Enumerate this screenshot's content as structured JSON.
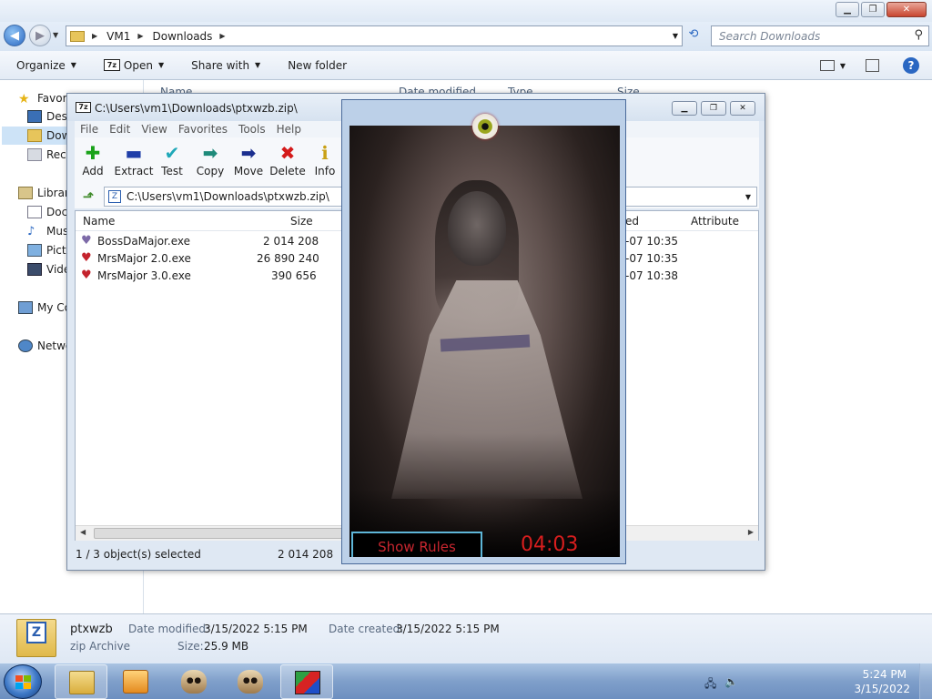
{
  "explorer": {
    "window_controls": {
      "minimize": "▁",
      "maximize": "❐",
      "close": "✕"
    },
    "address": {
      "crumbs": [
        "VM1",
        "Downloads"
      ]
    },
    "search_placeholder": "Search Downloads",
    "commands": {
      "organize": "Organize",
      "open": "Open",
      "share": "Share with",
      "new_folder": "New folder",
      "open_logo": "7z"
    },
    "nav": {
      "favorites": "Favori",
      "desktop": "Desk",
      "downloads": "Dow",
      "recent": "Rece",
      "libraries": "Librari",
      "documents": "Doc",
      "music": "Mus",
      "pictures": "Pictu",
      "videos": "Vide",
      "my_computer": "My Co",
      "network": "Netwo"
    },
    "columns": {
      "name": "Name",
      "date_modified": "Date modified",
      "type": "Type",
      "size": "Size"
    },
    "details": {
      "file_name": "ptxwzb",
      "file_type": "zip Archive",
      "modified_label": "Date modified:",
      "modified_value": "3/15/2022 5:15 PM",
      "size_label": "Size:",
      "size_value": "25.9 MB",
      "created_label": "Date created:",
      "created_value": "3/15/2022 5:15 PM"
    }
  },
  "zip": {
    "title": "C:\\Users\\vm1\\Downloads\\ptxwzb.zip\\",
    "logo": "7z",
    "menu": [
      "File",
      "Edit",
      "View",
      "Favorites",
      "Tools",
      "Help"
    ],
    "toolbar": [
      {
        "label": "Add",
        "glyph": "✚",
        "color": "#1aa21a"
      },
      {
        "label": "Extract",
        "glyph": "▬",
        "color": "#1f3ea8"
      },
      {
        "label": "Test",
        "glyph": "✔",
        "color": "#1fa8b8"
      },
      {
        "label": "Copy",
        "glyph": "➡",
        "color": "#1e8a7a"
      },
      {
        "label": "Move",
        "glyph": "➡",
        "color": "#1b2f8f"
      },
      {
        "label": "Delete",
        "glyph": "✖",
        "color": "#d41a1a"
      },
      {
        "label": "Info",
        "glyph": "ℹ",
        "color": "#c9a014"
      }
    ],
    "path": "C:\\Users\\vm1\\Downloads\\ptxwzb.zip\\",
    "columns": {
      "name": "Name",
      "size": "Size",
      "modified_tail": "ed",
      "attributes": "Attribute"
    },
    "files": [
      {
        "name": "BossDaMajor.exe",
        "size": "2 014 208",
        "modified": "-07 10:35"
      },
      {
        "name": "MrsMajor 2.0.exe",
        "size": "26 890 240",
        "modified": "-07 10:35"
      },
      {
        "name": "MrsMajor 3.0.exe",
        "size": "390 656",
        "modified": "-07 10:38"
      }
    ],
    "status": {
      "selection": "1 / 3 object(s) selected",
      "size": "2 014 208"
    }
  },
  "prank": {
    "button": "Show Rules",
    "timer": "04:03"
  },
  "taskbar": {
    "time": "5:24 PM",
    "date": "3/15/2022"
  },
  "colors": {
    "accent": "#2a67c2",
    "timer": "#d81e1e",
    "button_text": "#c8262f"
  }
}
